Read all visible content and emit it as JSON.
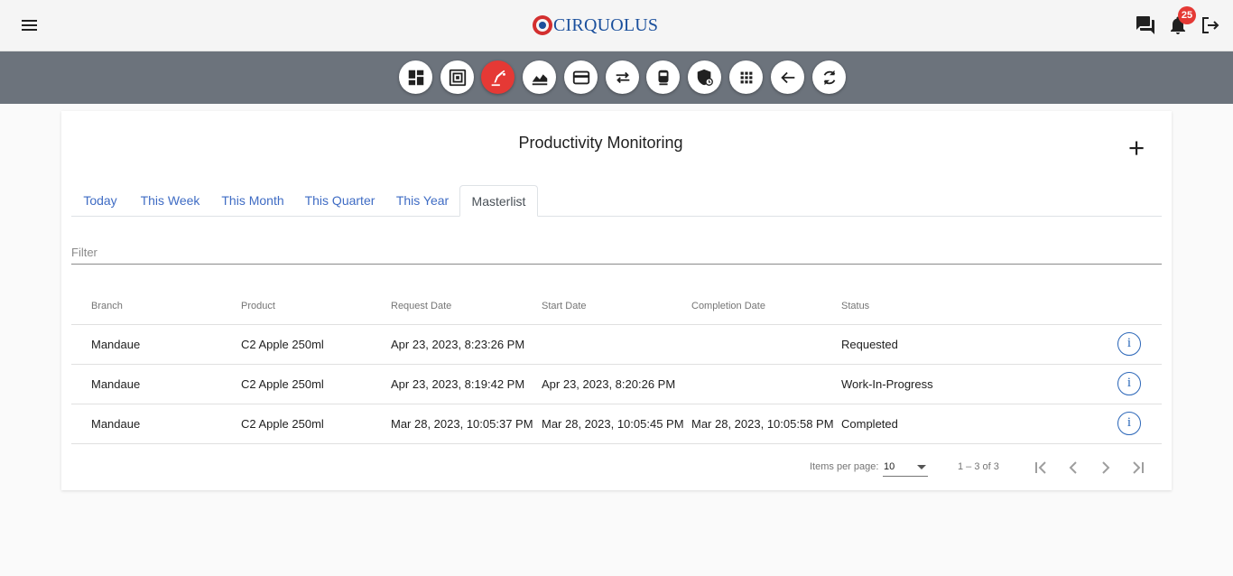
{
  "brand": {
    "name": "CIRQUOLUS",
    "accent": "#e53935",
    "primary": "#1a4f9c"
  },
  "header": {
    "menu_icon": "hamburger-menu-icon",
    "notifications_count": "25",
    "icons": [
      "chat-icon",
      "bell-icon",
      "logout-icon"
    ]
  },
  "toolbar": {
    "buttons": [
      {
        "icon": "dashboard-icon",
        "active": false
      },
      {
        "icon": "frame-icon",
        "active": false
      },
      {
        "icon": "production-icon",
        "active": true
      },
      {
        "icon": "chart-area-icon",
        "active": false
      },
      {
        "icon": "credit-card-icon",
        "active": false
      },
      {
        "icon": "swap-arrows-icon",
        "active": false
      },
      {
        "icon": "transit-icon",
        "active": false
      },
      {
        "icon": "shield-icon",
        "active": false
      },
      {
        "icon": "apps-grid-icon",
        "active": false
      },
      {
        "icon": "arrow-back-icon",
        "active": false
      },
      {
        "icon": "refresh-icon",
        "active": false
      }
    ]
  },
  "page": {
    "title": "Productivity Monitoring",
    "add_icon": "plus-icon"
  },
  "tabs": [
    {
      "label": "Today"
    },
    {
      "label": "This Week"
    },
    {
      "label": "This Month"
    },
    {
      "label": "This Quarter"
    },
    {
      "label": "This Year"
    },
    {
      "label": "Masterlist",
      "active": true
    }
  ],
  "filter": {
    "placeholder": "Filter",
    "value": ""
  },
  "table": {
    "columns": [
      "Branch",
      "Product",
      "Request Date",
      "Start Date",
      "Completion Date",
      "Status"
    ],
    "rows": [
      [
        "Mandaue",
        "C2 Apple 250ml",
        "Apr 23, 2023, 8:23:26 PM",
        "",
        "",
        "Requested"
      ],
      [
        "Mandaue",
        "C2 Apple 250ml",
        "Apr 23, 2023, 8:19:42 PM",
        "Apr 23, 2023, 8:20:26 PM",
        "",
        "Work-In-Progress"
      ],
      [
        "Mandaue",
        "C2 Apple 250ml",
        "Mar 28, 2023, 10:05:37 PM",
        "Mar 28, 2023, 10:05:45 PM",
        "Mar 28, 2023, 10:05:58 PM",
        "Completed"
      ]
    ],
    "info_icon": "info-icon",
    "info_glyph": "i"
  },
  "paginator": {
    "items_per_page_label": "Items per page:",
    "items_per_page": "10",
    "range": "1 – 3 of 3",
    "nav_icons": [
      "first-page-icon",
      "previous-page-icon",
      "next-page-icon",
      "last-page-icon"
    ]
  }
}
